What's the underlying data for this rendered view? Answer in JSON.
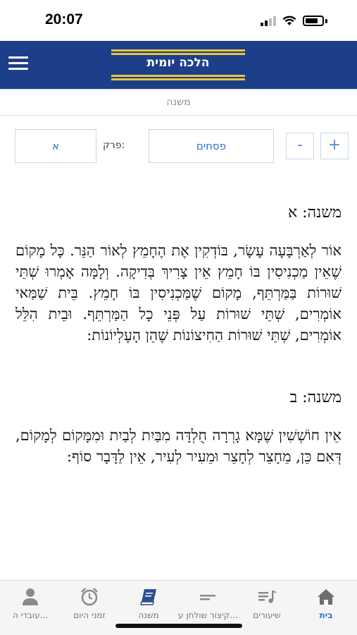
{
  "status": {
    "time": "20:07"
  },
  "header": {
    "title": "הלכה יומית"
  },
  "section": {
    "label": "משנה"
  },
  "controls": {
    "plus": "+",
    "minus": "-",
    "tractate": "פסחים",
    "chapter_label": "פרק:",
    "chapter": "א"
  },
  "mishnayot": [
    {
      "heading": "משנה: א",
      "text": "אוֹר לְאַרְבָּעָה עָשָׂר, בּוֹדְקִין אֶת הֶחָמֵץ לְאוֹר הַנֵּר. כָּל מָקוֹם שֶׁאֵין מַכְנִיסִין בּוֹ חָמֵץ אֵין צָרִיךְ בְּדִיקָה. וְלָמָּה אָמְרוּ שְׁתֵּי שׁוּרוֹת בַּמַּרְתֵּף, מָקוֹם שֶׁמַּכְנִיסִין בּוֹ חָמֵץ. בֵּית שַׁמַּאי אוֹמְרִים, שְׁתֵּי שׁוּרוֹת עַל פְּנֵי כָל הַמַּרְתֵּף. וּבֵית הִלֵּל אוֹמְרִים, שְׁתֵּי שׁוּרוֹת הַחִיצוֹנוֹת שֶׁהֵן הָעֶלְיוֹנוֹת:"
    },
    {
      "heading": "משנה: ב",
      "text": "אֵין חוֹשְׁשִׁין שֶׁמָּא גָרְרָה חֻלְדָּה מִבַּיִת לְבַיִת וּמִמָּקוֹם לְמָקוֹם, דְּאִם כֵּן, מֵחָצֵר לְחָצֵר וּמֵעִיר לְעִיר, אֵין לַדָּבָר סוֹף:"
    }
  ],
  "nav": {
    "home": "בית",
    "lessons": "שיעורים",
    "summary": "קיצור שולחן ע...",
    "mishna": "משנה",
    "times": "זמני היום",
    "workers": "עובדי ה..."
  },
  "colors": {
    "header": "#1d3f8a",
    "accent": "#2f6fcf",
    "gold": "#e6c640"
  }
}
